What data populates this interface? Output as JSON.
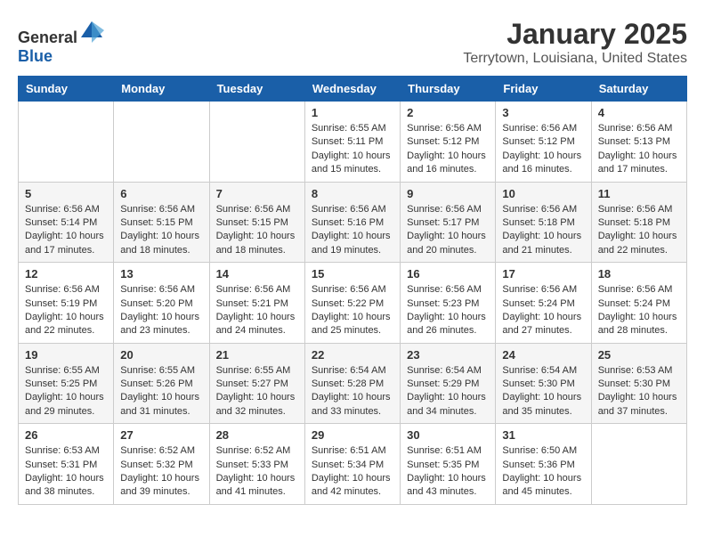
{
  "header": {
    "logo_general": "General",
    "logo_blue": "Blue",
    "month": "January 2025",
    "location": "Terrytown, Louisiana, United States"
  },
  "weekdays": [
    "Sunday",
    "Monday",
    "Tuesday",
    "Wednesday",
    "Thursday",
    "Friday",
    "Saturday"
  ],
  "weeks": [
    [
      {
        "day": "",
        "sunrise": "",
        "sunset": "",
        "daylight": ""
      },
      {
        "day": "",
        "sunrise": "",
        "sunset": "",
        "daylight": ""
      },
      {
        "day": "",
        "sunrise": "",
        "sunset": "",
        "daylight": ""
      },
      {
        "day": "1",
        "sunrise": "Sunrise: 6:55 AM",
        "sunset": "Sunset: 5:11 PM",
        "daylight": "Daylight: 10 hours and 15 minutes."
      },
      {
        "day": "2",
        "sunrise": "Sunrise: 6:56 AM",
        "sunset": "Sunset: 5:12 PM",
        "daylight": "Daylight: 10 hours and 16 minutes."
      },
      {
        "day": "3",
        "sunrise": "Sunrise: 6:56 AM",
        "sunset": "Sunset: 5:12 PM",
        "daylight": "Daylight: 10 hours and 16 minutes."
      },
      {
        "day": "4",
        "sunrise": "Sunrise: 6:56 AM",
        "sunset": "Sunset: 5:13 PM",
        "daylight": "Daylight: 10 hours and 17 minutes."
      }
    ],
    [
      {
        "day": "5",
        "sunrise": "Sunrise: 6:56 AM",
        "sunset": "Sunset: 5:14 PM",
        "daylight": "Daylight: 10 hours and 17 minutes."
      },
      {
        "day": "6",
        "sunrise": "Sunrise: 6:56 AM",
        "sunset": "Sunset: 5:15 PM",
        "daylight": "Daylight: 10 hours and 18 minutes."
      },
      {
        "day": "7",
        "sunrise": "Sunrise: 6:56 AM",
        "sunset": "Sunset: 5:15 PM",
        "daylight": "Daylight: 10 hours and 18 minutes."
      },
      {
        "day": "8",
        "sunrise": "Sunrise: 6:56 AM",
        "sunset": "Sunset: 5:16 PM",
        "daylight": "Daylight: 10 hours and 19 minutes."
      },
      {
        "day": "9",
        "sunrise": "Sunrise: 6:56 AM",
        "sunset": "Sunset: 5:17 PM",
        "daylight": "Daylight: 10 hours and 20 minutes."
      },
      {
        "day": "10",
        "sunrise": "Sunrise: 6:56 AM",
        "sunset": "Sunset: 5:18 PM",
        "daylight": "Daylight: 10 hours and 21 minutes."
      },
      {
        "day": "11",
        "sunrise": "Sunrise: 6:56 AM",
        "sunset": "Sunset: 5:18 PM",
        "daylight": "Daylight: 10 hours and 22 minutes."
      }
    ],
    [
      {
        "day": "12",
        "sunrise": "Sunrise: 6:56 AM",
        "sunset": "Sunset: 5:19 PM",
        "daylight": "Daylight: 10 hours and 22 minutes."
      },
      {
        "day": "13",
        "sunrise": "Sunrise: 6:56 AM",
        "sunset": "Sunset: 5:20 PM",
        "daylight": "Daylight: 10 hours and 23 minutes."
      },
      {
        "day": "14",
        "sunrise": "Sunrise: 6:56 AM",
        "sunset": "Sunset: 5:21 PM",
        "daylight": "Daylight: 10 hours and 24 minutes."
      },
      {
        "day": "15",
        "sunrise": "Sunrise: 6:56 AM",
        "sunset": "Sunset: 5:22 PM",
        "daylight": "Daylight: 10 hours and 25 minutes."
      },
      {
        "day": "16",
        "sunrise": "Sunrise: 6:56 AM",
        "sunset": "Sunset: 5:23 PM",
        "daylight": "Daylight: 10 hours and 26 minutes."
      },
      {
        "day": "17",
        "sunrise": "Sunrise: 6:56 AM",
        "sunset": "Sunset: 5:24 PM",
        "daylight": "Daylight: 10 hours and 27 minutes."
      },
      {
        "day": "18",
        "sunrise": "Sunrise: 6:56 AM",
        "sunset": "Sunset: 5:24 PM",
        "daylight": "Daylight: 10 hours and 28 minutes."
      }
    ],
    [
      {
        "day": "19",
        "sunrise": "Sunrise: 6:55 AM",
        "sunset": "Sunset: 5:25 PM",
        "daylight": "Daylight: 10 hours and 29 minutes."
      },
      {
        "day": "20",
        "sunrise": "Sunrise: 6:55 AM",
        "sunset": "Sunset: 5:26 PM",
        "daylight": "Daylight: 10 hours and 31 minutes."
      },
      {
        "day": "21",
        "sunrise": "Sunrise: 6:55 AM",
        "sunset": "Sunset: 5:27 PM",
        "daylight": "Daylight: 10 hours and 32 minutes."
      },
      {
        "day": "22",
        "sunrise": "Sunrise: 6:54 AM",
        "sunset": "Sunset: 5:28 PM",
        "daylight": "Daylight: 10 hours and 33 minutes."
      },
      {
        "day": "23",
        "sunrise": "Sunrise: 6:54 AM",
        "sunset": "Sunset: 5:29 PM",
        "daylight": "Daylight: 10 hours and 34 minutes."
      },
      {
        "day": "24",
        "sunrise": "Sunrise: 6:54 AM",
        "sunset": "Sunset: 5:30 PM",
        "daylight": "Daylight: 10 hours and 35 minutes."
      },
      {
        "day": "25",
        "sunrise": "Sunrise: 6:53 AM",
        "sunset": "Sunset: 5:30 PM",
        "daylight": "Daylight: 10 hours and 37 minutes."
      }
    ],
    [
      {
        "day": "26",
        "sunrise": "Sunrise: 6:53 AM",
        "sunset": "Sunset: 5:31 PM",
        "daylight": "Daylight: 10 hours and 38 minutes."
      },
      {
        "day": "27",
        "sunrise": "Sunrise: 6:52 AM",
        "sunset": "Sunset: 5:32 PM",
        "daylight": "Daylight: 10 hours and 39 minutes."
      },
      {
        "day": "28",
        "sunrise": "Sunrise: 6:52 AM",
        "sunset": "Sunset: 5:33 PM",
        "daylight": "Daylight: 10 hours and 41 minutes."
      },
      {
        "day": "29",
        "sunrise": "Sunrise: 6:51 AM",
        "sunset": "Sunset: 5:34 PM",
        "daylight": "Daylight: 10 hours and 42 minutes."
      },
      {
        "day": "30",
        "sunrise": "Sunrise: 6:51 AM",
        "sunset": "Sunset: 5:35 PM",
        "daylight": "Daylight: 10 hours and 43 minutes."
      },
      {
        "day": "31",
        "sunrise": "Sunrise: 6:50 AM",
        "sunset": "Sunset: 5:36 PM",
        "daylight": "Daylight: 10 hours and 45 minutes."
      },
      {
        "day": "",
        "sunrise": "",
        "sunset": "",
        "daylight": ""
      }
    ]
  ]
}
